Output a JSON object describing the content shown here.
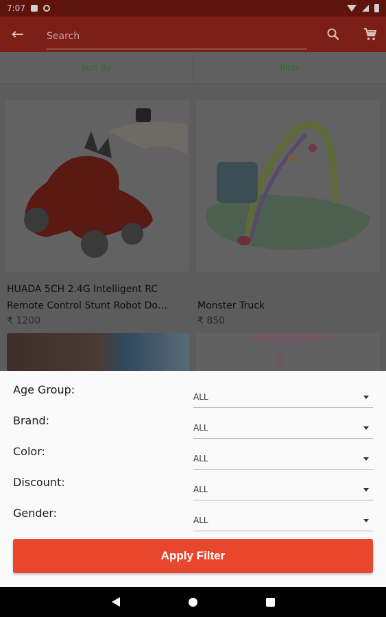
{
  "status_bar": {
    "time": "7:07"
  },
  "app_bar": {
    "back_glyph": "←",
    "search_placeholder": "Search",
    "search_icon": "search-icon",
    "cart_icon": "cart-icon",
    "background": "#7b1e16"
  },
  "toolbar": {
    "sort_label": "Sort By",
    "filter_label": "filter",
    "label_color": "#2e6a2c"
  },
  "products": [
    {
      "title_line1": "HUADA 5CH 2.4G Intelligent RC",
      "title_line2": "Remote Control Stunt Robot Do…",
      "price": "₹ 1200"
    },
    {
      "title_line1": "",
      "title_line2": "Monster Truck",
      "price": "₹ 850"
    }
  ],
  "filters": [
    {
      "label": "Age Group:",
      "value": "ALL"
    },
    {
      "label": "Brand:",
      "value": "ALL"
    },
    {
      "label": "Color:",
      "value": "ALL"
    },
    {
      "label": "Discount:",
      "value": "ALL"
    },
    {
      "label": "Gender:",
      "value": "ALL"
    }
  ],
  "apply_button": {
    "label": "Apply Filter",
    "color": "#e8472e"
  }
}
